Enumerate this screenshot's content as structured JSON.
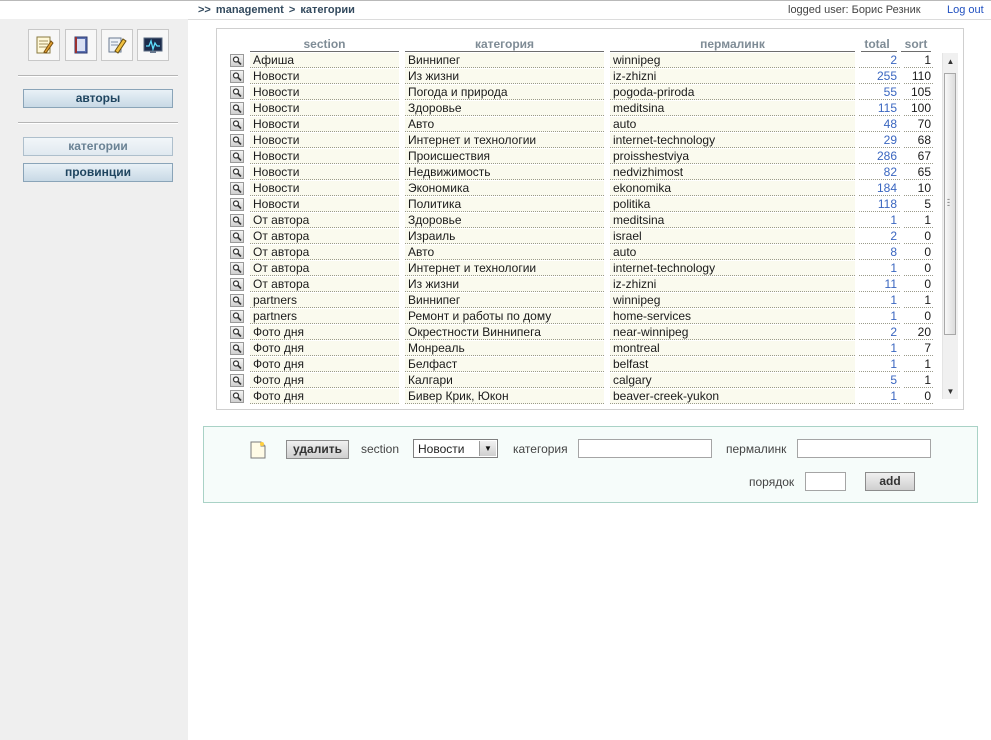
{
  "breadcrumb": {
    "prefix": ">>",
    "root": "management",
    "sep": ">",
    "current": "категории"
  },
  "user": {
    "text": "logged user: Борис Резник",
    "logout": "Log out"
  },
  "toolbar": {
    "icons": [
      "notepad-icon",
      "book-icon",
      "edit-pencil-icon",
      "monitor-chart-icon"
    ]
  },
  "nav": {
    "authors": "авторы",
    "categories": "категории",
    "provinces": "провинции"
  },
  "table": {
    "headers": {
      "section": "section",
      "category": "категория",
      "permalink": "пермалинк",
      "total": "total",
      "sort": "sort"
    },
    "rows": [
      {
        "section": "Афиша",
        "category": "Виннипег",
        "permalink": "winnipeg",
        "total": "2",
        "sort": "1"
      },
      {
        "section": "Новости",
        "category": "Из жизни",
        "permalink": "iz-zhizni",
        "total": "255",
        "sort": "110"
      },
      {
        "section": "Новости",
        "category": "Погода и природа",
        "permalink": "pogoda-priroda",
        "total": "55",
        "sort": "105"
      },
      {
        "section": "Новости",
        "category": "Здоровье",
        "permalink": "meditsina",
        "total": "115",
        "sort": "100"
      },
      {
        "section": "Новости",
        "category": "Авто",
        "permalink": "auto",
        "total": "48",
        "sort": "70"
      },
      {
        "section": "Новости",
        "category": "Интернет и технологии",
        "permalink": "internet-technology",
        "total": "29",
        "sort": "68"
      },
      {
        "section": "Новости",
        "category": "Происшествия",
        "permalink": "proisshestviya",
        "total": "286",
        "sort": "67"
      },
      {
        "section": "Новости",
        "category": "Недвижимость",
        "permalink": "nedvizhimost",
        "total": "82",
        "sort": "65"
      },
      {
        "section": "Новости",
        "category": "Экономика",
        "permalink": "ekonomika",
        "total": "184",
        "sort": "10"
      },
      {
        "section": "Новости",
        "category": "Политика",
        "permalink": "politika",
        "total": "118",
        "sort": "5"
      },
      {
        "section": "От автора",
        "category": "Здоровье",
        "permalink": "meditsina",
        "total": "1",
        "sort": "1"
      },
      {
        "section": "От автора",
        "category": "Израиль",
        "permalink": "israel",
        "total": "2",
        "sort": "0"
      },
      {
        "section": "От автора",
        "category": "Авто",
        "permalink": "auto",
        "total": "8",
        "sort": "0"
      },
      {
        "section": "От автора",
        "category": "Интернет и технологии",
        "permalink": "internet-technology",
        "total": "1",
        "sort": "0"
      },
      {
        "section": "От автора",
        "category": "Из жизни",
        "permalink": "iz-zhizni",
        "total": "11",
        "sort": "0"
      },
      {
        "section": "partners",
        "category": "Виннипег",
        "permalink": "winnipeg",
        "total": "1",
        "sort": "1"
      },
      {
        "section": "partners",
        "category": "Ремонт и работы по дому",
        "permalink": "home-services",
        "total": "1",
        "sort": "0"
      },
      {
        "section": "Фото дня",
        "category": "Окрестности Виннипега",
        "permalink": "near-winnipeg",
        "total": "2",
        "sort": "20"
      },
      {
        "section": "Фото дня",
        "category": "Монреаль",
        "permalink": "montreal",
        "total": "1",
        "sort": "7"
      },
      {
        "section": "Фото дня",
        "category": "Белфаст",
        "permalink": "belfast",
        "total": "1",
        "sort": "1"
      },
      {
        "section": "Фото дня",
        "category": "Калгари",
        "permalink": "calgary",
        "total": "5",
        "sort": "1"
      },
      {
        "section": "Фото дня",
        "category": "Бивер Крик, Юкон",
        "permalink": "beaver-creek-yukon",
        "total": "1",
        "sort": "0"
      }
    ]
  },
  "form": {
    "delete_label": "удалить",
    "section_label": "section",
    "section_value": "Новости",
    "category_label": "категория",
    "category_value": "",
    "permalink_label": "пермалинк",
    "permalink_value": "",
    "order_label": "порядок",
    "order_value": "",
    "add_label": "add"
  },
  "colors": {
    "link": "#3a66c0",
    "row_bg": "#fafaee",
    "form_border": "#a9d2c6",
    "nav_text": "#1f4560"
  }
}
